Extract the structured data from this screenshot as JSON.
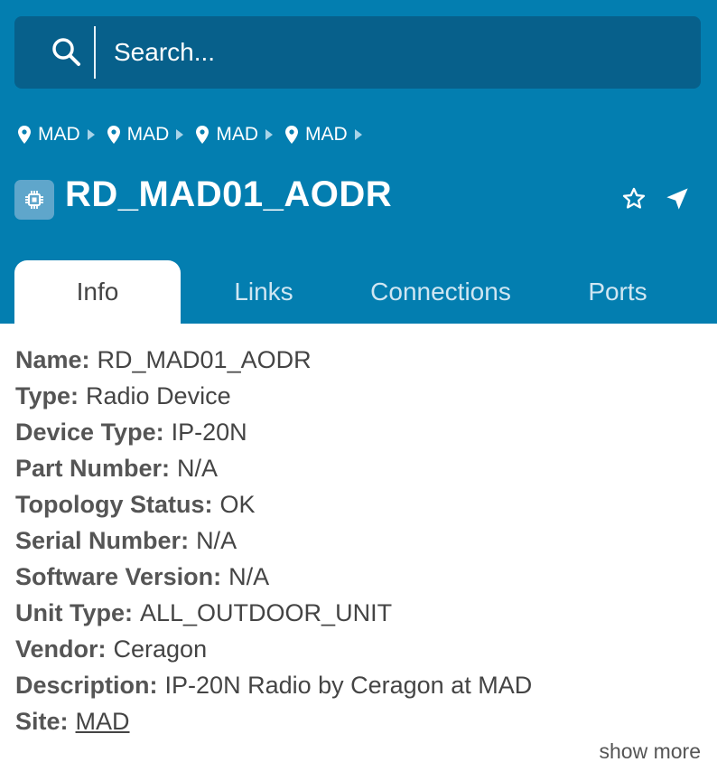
{
  "search": {
    "placeholder": "Search..."
  },
  "breadcrumb": [
    {
      "label": "MAD"
    },
    {
      "label": "MAD"
    },
    {
      "label": "MAD"
    },
    {
      "label": "MAD"
    }
  ],
  "device": {
    "title": "RD_MAD01_AODR"
  },
  "tabs": [
    {
      "label": "Info"
    },
    {
      "label": "Links"
    },
    {
      "label": "Connections"
    },
    {
      "label": "Ports"
    }
  ],
  "info": [
    {
      "key": "Name:",
      "value": "RD_MAD01_AODR"
    },
    {
      "key": "Type:",
      "value": "Radio Device"
    },
    {
      "key": "Device Type:",
      "value": "IP-20N"
    },
    {
      "key": "Part Number:",
      "value": "N/A"
    },
    {
      "key": "Topology Status:",
      "value": "OK"
    },
    {
      "key": "Serial Number:",
      "value": "N/A"
    },
    {
      "key": "Software Version:",
      "value": "N/A"
    },
    {
      "key": "Unit Type:",
      "value": "ALL_OUTDOOR_UNIT"
    },
    {
      "key": "Vendor:",
      "value": "Ceragon"
    },
    {
      "key": "Description:",
      "value": "IP-20N Radio by Ceragon at MAD"
    },
    {
      "key": "Site:",
      "value": "MAD"
    }
  ],
  "show_more": "show more",
  "colors": {
    "header": "#037eb0",
    "search": "#07608b",
    "text": "#444444"
  }
}
